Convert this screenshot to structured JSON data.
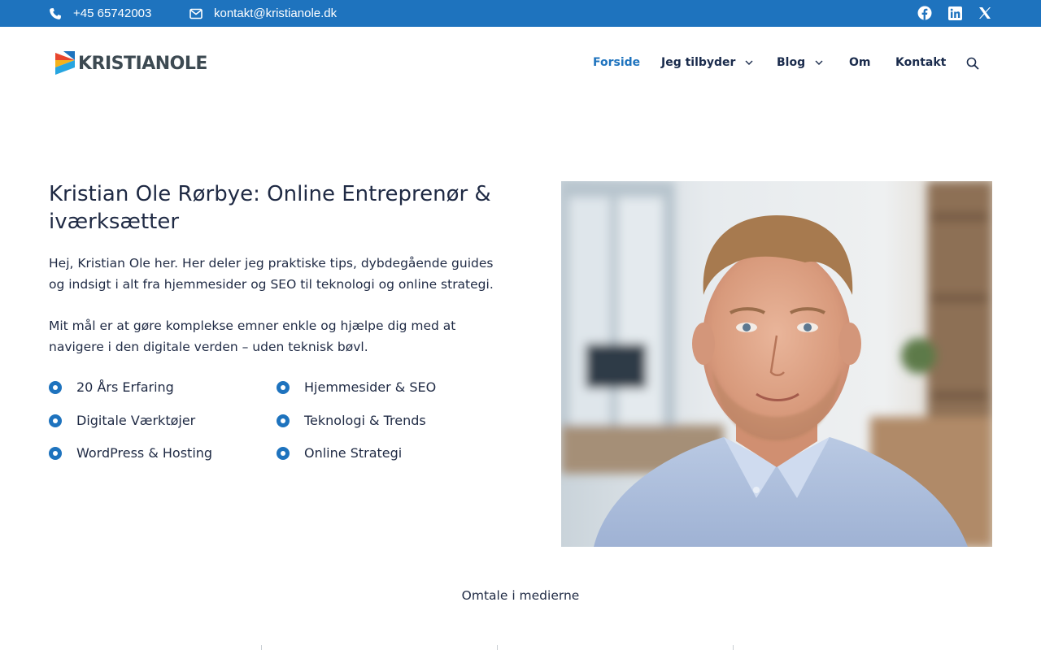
{
  "topbar": {
    "phone": "+45 65742003",
    "email": "kontakt@kristianole.dk",
    "social": [
      "facebook-icon",
      "linkedin-icon",
      "x-icon"
    ],
    "bg_color": "#1e73be"
  },
  "header": {
    "logo_text": "KRISTIANOLE",
    "nav": {
      "forside": "Forside",
      "jeg_tilbyder": "Jeg tilbyder",
      "blog": "Blog",
      "om": "Om",
      "kontakt": "Kontakt"
    },
    "active_color": "#1e73be"
  },
  "hero": {
    "title": "Kristian Ole Rørbye: Online Entreprenør & iværksætter",
    "paragraph1": "Hej, Kristian Ole her. Her deler jeg praktiske tips, dybdegående guides og indsigt i alt fra hjemmesider og SEO til teknologi og online strategi.",
    "paragraph2": "Mit mål er at gøre komplekse emner enkle og hjælpe dig med at navigere i den digitale verden – uden teknisk bøvl.",
    "features": [
      "20 Års Erfaring",
      "Hjemmesider & SEO",
      "Digitale Værktøjer",
      "Teknologi & Trends",
      "WordPress & Hosting",
      "Online Strategi"
    ]
  },
  "media": {
    "label": "Omtale i medierne"
  }
}
